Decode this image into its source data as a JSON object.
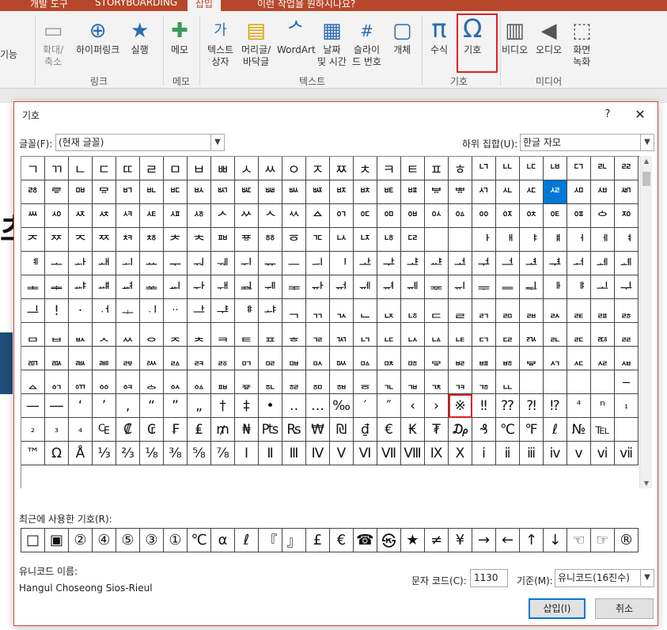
{
  "ribbon": {
    "tabs": [
      "개발 도구",
      "STORYBOARDING",
      "삽입",
      "이런 작업을 원하시나요?"
    ],
    "left_fragment": "기능",
    "left_group_fragment": "능",
    "buttons": {
      "zoom": [
        "확대/",
        "축소"
      ],
      "hyperlink": "하이퍼링크",
      "action": "실행",
      "comment": "메모",
      "textbox": [
        "텍스트",
        "상자"
      ],
      "header_footer": [
        "머리글/",
        "바닥글"
      ],
      "wordart": "WordArt",
      "datetime": [
        "날짜",
        "및 시간"
      ],
      "slide_number": [
        "슬라이",
        "드 번호"
      ],
      "object": "개체",
      "equation": "수식",
      "symbol": "기호",
      "video": "비디오",
      "audio": "오디오",
      "screen_record": [
        "화면",
        "녹화"
      ]
    },
    "groups": {
      "links": "링크",
      "comments": "메모",
      "text": "텍스트",
      "symbols": "기호",
      "media": "미디어"
    }
  },
  "slide": {
    "fragment_char": "츠"
  },
  "dialog": {
    "title": "기호",
    "help": "?",
    "close": "✕",
    "font_label": "글꼴(F):",
    "font_value": "(현재 글꼴)",
    "subset_label": "하위 집합(U):",
    "subset_value": "한글 자모",
    "grid_rows": [
      [
        "ㄱ",
        "ㄲ",
        "ㄴ",
        "ㄷ",
        "ㄸ",
        "ㄹ",
        "ㅁ",
        "ㅂ",
        "ㅃ",
        "ㅅ",
        "ㅆ",
        "ㅇ",
        "ㅈ",
        "ㅉ",
        "ㅊ",
        "ㅋ",
        "ㅌ",
        "ㅍ",
        "ㅎ",
        "ᄓ",
        "ᄔ",
        "ᄕ",
        "ᄖ",
        "ᄗ",
        "ᄘ",
        "ᄙ"
      ],
      [
        "ᄚ",
        "ᄛ",
        "ᄜ",
        "ᄝ",
        "ᄞ",
        "ᄟ",
        "ᄠ",
        "ᄡ",
        "ᄢ",
        "ᄣ",
        "ᄤ",
        "ᄥ",
        "ᄦ",
        "ᄧ",
        "ᄨ",
        "ᄩ",
        "ᄪ",
        "ᄫ",
        "ᄬ",
        "ᄭ",
        "ᄮ",
        "ᄯ",
        "ᄰ",
        "ᄱ",
        "ᄲ",
        "ᄳ"
      ],
      [
        "ᄴ",
        "ᄵ",
        "ᄶ",
        "ᄷ",
        "ᄸ",
        "ᄹ",
        "ᄺ",
        "ᄻ",
        "ᄼ",
        "ᄽ",
        "ᄾ",
        "ᄿ",
        "ᅀ",
        "ᅁ",
        "ᅂ",
        "ᅃ",
        "ᅄ",
        "ᅅ",
        "ᅆ",
        "ᅇ",
        "ᅈ",
        "ᅉ",
        "ᅊ",
        "ᅋ",
        "ᅌ",
        "ᅍ"
      ],
      [
        "ᅎ",
        "ᅏ",
        "ᅐ",
        "ᅑ",
        "ᅒ",
        "ᅓ",
        "ᅔ",
        "ᅕ",
        "ᅖ",
        "ᅗ",
        "ᅘ",
        "ᅙ",
        "ᅚ",
        "ᅛ",
        "ᅜ",
        "ᅝ",
        "ᅞ",
        "",
        "",
        "ᅡ",
        "ᅢ",
        "ᅣ",
        "ᅤ",
        "ᅥ",
        "ᅦ",
        "ᅧ"
      ],
      [
        "ᅨ",
        "ᅩ",
        "ᅪ",
        "ᅫ",
        "ᅬ",
        "ᅭ",
        "ᅮ",
        "ᅯ",
        "ᅰ",
        "ᅱ",
        "ᅲ",
        "ᅳ",
        "ᅴ",
        "ᅵ",
        "ᅶ",
        "ᅷ",
        "ᅸ",
        "ᅹ",
        "ᅺ",
        "ᅻ",
        "ᅼ",
        "ᅽ",
        "ᅾ",
        "ᅿ",
        "ᆀ",
        "ᆁ"
      ],
      [
        "ᆂ",
        "ᆃ",
        "ᆄ",
        "ᆅ",
        "ᆆ",
        "ᆇ",
        "ᆈ",
        "ᆉ",
        "ᆊ",
        "ᆋ",
        "ᆌ",
        "ᆍ",
        "ᆎ",
        "ᆏ",
        "ᆐ",
        "ᆑ",
        "ᆒ",
        "ᆓ",
        "ᆔ",
        "ᆕ",
        "ᆖ",
        "ᆗ",
        "ᆘ",
        "ᆙ",
        "ᆚ",
        "ᆛ"
      ],
      [
        "ᆜ",
        "!",
        "·",
        "ᆟ",
        "ᆠ",
        "ᆡ",
        "··",
        "ᆣ",
        "ᆤ",
        "ᆥ",
        "ᆦ",
        "ᆨ",
        "ᆩ",
        "ᆪ",
        "ᆫ",
        "ᆬ",
        "ᆭ",
        "ᆮ",
        "ᆯ",
        "ᆰ",
        "ᆱ",
        "ᆲ",
        "ᆳ",
        "ᆴ",
        "ᆵ",
        "ᆶ"
      ],
      [
        "ᆷ",
        "ᆸ",
        "ᆹ",
        "ᆺ",
        "ᆻ",
        "ᆼ",
        "ᆽ",
        "ᆾ",
        "ᆿ",
        "ᇀ",
        "ᇁ",
        "ᇂ",
        "ᇃ",
        "ᇄ",
        "ᇅ",
        "ᇆ",
        "ᇇ",
        "ᇈ",
        "ᇉ",
        "ᇊ",
        "ᇋ",
        "ᇌ",
        "ᇍ",
        "ᇎ",
        "ᇏ",
        "ᇐ"
      ],
      [
        "ᇑ",
        "ᇒ",
        "ᇓ",
        "ᇔ",
        "ᇕ",
        "ᇖ",
        "ᇗ",
        "ᇘ",
        "ᇙ",
        "ᇚ",
        "ᇛ",
        "ᇜ",
        "ᇝ",
        "ᇞ",
        "ᇟ",
        "ᇠ",
        "ᇡ",
        "ᇢ",
        "ᇣ",
        "ᇤ",
        "ᇥ",
        "ᇦ",
        "ᇧ",
        "ᇨ",
        "ᇩ",
        "ᇪ"
      ],
      [
        "ᇫ",
        "ᇬ",
        "ᇭ",
        "ᇮ",
        "ᇯ",
        "ᇰ",
        "ᇱ",
        "ᇲ",
        "ᇳ",
        "ᇴ",
        "ᇵ",
        "ᇶ",
        "ᇷ",
        "ᇸ",
        "ᇹ",
        "ᇺ",
        "ᇻ",
        "ᇼ",
        "ᇽ",
        "ᇾ",
        "ᇿ",
        "",
        "",
        "",
        "",
        "‒"
      ],
      [
        "—",
        "―",
        "‘",
        "’",
        "‚",
        "“",
        "”",
        "„",
        "†",
        "‡",
        "•",
        "‥",
        "…",
        "‰",
        "′",
        "″",
        "‹",
        "›",
        "※",
        "‼",
        "⁇",
        "⁈",
        "⁉",
        "⁴",
        "ⁿ",
        "₁"
      ],
      [
        "₂",
        "₃",
        "₄",
        "₠",
        "₡",
        "₢",
        "₣",
        "₤",
        "₥",
        "₦",
        "₧",
        "₨",
        "₩",
        "₪",
        "₫",
        "€",
        "₭",
        "₮",
        "₯",
        "₰",
        "℃",
        "℉",
        "ℓ",
        "№",
        "℡"
      ],
      [
        "™",
        "Ω",
        "Å",
        "⅓",
        "⅔",
        "⅛",
        "⅜",
        "⅝",
        "⅞",
        "Ⅰ",
        "Ⅱ",
        "Ⅲ",
        "Ⅳ",
        "Ⅴ",
        "Ⅵ",
        "Ⅶ",
        "Ⅷ",
        "Ⅸ",
        "Ⅹ",
        "ⅰ",
        "ⅱ",
        "ⅲ",
        "ⅳ",
        "ⅴ",
        "ⅵ",
        "ⅶ"
      ]
    ],
    "recent_label": "최근에 사용한 기호(R):",
    "recent_symbols": [
      "□",
      "▣",
      "②",
      "④",
      "⑤",
      "③",
      "①",
      "℃",
      "α",
      "ℓ",
      "『",
      "』",
      "£",
      "€",
      "☎",
      "㉿",
      "★",
      "≠",
      "¥",
      "→",
      "←",
      "↑",
      "↓",
      "☜",
      "☞",
      "®"
    ],
    "unicode_name_label": "유니코드 이름:",
    "unicode_name_value": "Hangul Choseong Sios-Rieul",
    "char_code_label": "문자 코드(C):",
    "char_code_value": "1130",
    "base_label": "기준(M):",
    "base_value": "유니코드(16진수)",
    "insert_button": "삽입(I)",
    "cancel_button": "취소"
  }
}
